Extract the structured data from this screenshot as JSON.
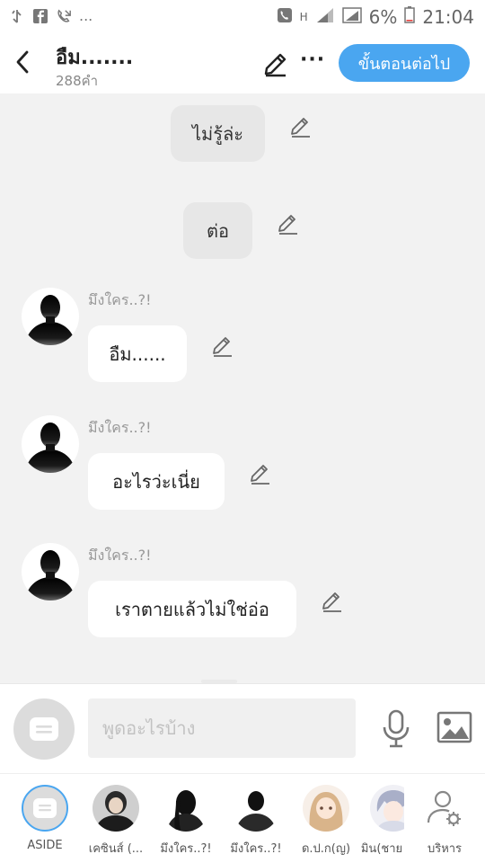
{
  "status_bar": {
    "battery": "6%",
    "time": "21:04",
    "left_icons": [
      "usb-icon",
      "facebook-icon",
      "missed-call-icon"
    ],
    "more": "...",
    "net_indicator": "H"
  },
  "header": {
    "title": "อืม.......",
    "subtitle": "288คำ",
    "next_label": "ขั้นตอนต่อไป",
    "more_label": "···"
  },
  "messages": [
    {
      "type": "narration",
      "text": "ไม่รู้ล่ะ"
    },
    {
      "type": "narration",
      "text": "ต่อ"
    },
    {
      "type": "character",
      "name": "มึงใคร..?!",
      "text": "อืม......"
    },
    {
      "type": "character",
      "name": "มึงใคร..?!",
      "text": "อะไรว่ะเนี่ย"
    },
    {
      "type": "character",
      "name": "มึงใคร..?!",
      "text": "เราตายแล้วไม่ใช่อ่อ"
    }
  ],
  "input": {
    "placeholder": "พูดอะไรบ้าง"
  },
  "bottom_tabs": [
    {
      "label": "ASIDE",
      "active": true
    },
    {
      "label": "เคซินส์ (..."
    },
    {
      "label": "มึงใคร..?!"
    },
    {
      "label": "มึงใคร..?!"
    },
    {
      "label": "ด.ป.ก(ญ)"
    },
    {
      "label": "มิน(ชาย"
    },
    {
      "label": "บริหาร"
    }
  ],
  "colors": {
    "accent": "#4aa6f0",
    "background": "#f2f2f2",
    "narration_bubble": "#e7e7e7",
    "character_bubble": "#ffffff"
  }
}
